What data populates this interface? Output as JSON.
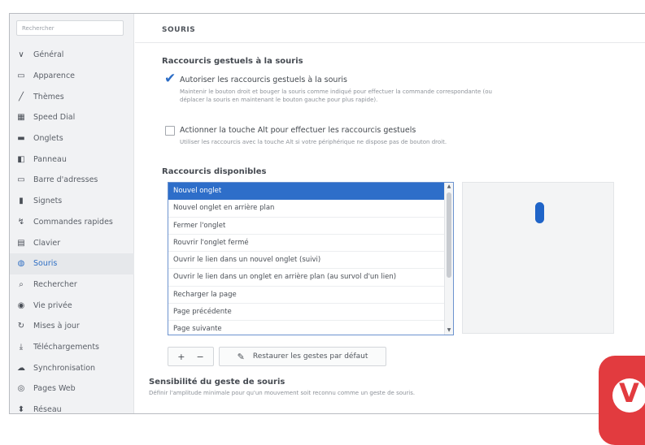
{
  "sidebar": {
    "search_placeholder": "Rechercher",
    "items": [
      {
        "label": "Général",
        "icon": "chevron-v-icon"
      },
      {
        "label": "Apparence",
        "icon": "folder-icon"
      },
      {
        "label": "Thèmes",
        "icon": "brush-icon"
      },
      {
        "label": "Speed Dial",
        "icon": "grid-icon"
      },
      {
        "label": "Onglets",
        "icon": "tabs-icon"
      },
      {
        "label": "Panneau",
        "icon": "panel-icon"
      },
      {
        "label": "Barre d'adresses",
        "icon": "address-bar-icon"
      },
      {
        "label": "Signets",
        "icon": "bookmark-icon"
      },
      {
        "label": "Commandes rapides",
        "icon": "quick-commands-icon"
      },
      {
        "label": "Clavier",
        "icon": "keyboard-icon"
      },
      {
        "label": "Souris",
        "icon": "mouse-icon"
      },
      {
        "label": "Rechercher",
        "icon": "search-icon"
      },
      {
        "label": "Vie privée",
        "icon": "privacy-icon"
      },
      {
        "label": "Mises à jour",
        "icon": "update-icon"
      },
      {
        "label": "Téléchargements",
        "icon": "download-icon"
      },
      {
        "label": "Synchronisation",
        "icon": "cloud-icon"
      },
      {
        "label": "Pages Web",
        "icon": "web-icon"
      },
      {
        "label": "Réseau",
        "icon": "network-icon"
      }
    ],
    "active_index": 10
  },
  "main": {
    "title": "SOURIS",
    "gestures_section": "Raccourcis gestuels à la souris",
    "option1": {
      "label": "Autoriser les raccourcis gestuels à la souris",
      "description": "Maintenir le bouton droit et bouger la souris comme indiqué pour effectuer la commande correspondante (ou déplacer la souris en maintenant le bouton gauche pour plus rapide).",
      "checked": true
    },
    "option2": {
      "label": "Actionner la touche Alt pour effectuer les raccourcis gestuels",
      "description": "Utiliser les raccourcis avec la touche Alt si votre périphérique ne dispose pas de bouton droit.",
      "checked": false
    },
    "available_section": "Raccourcis disponibles",
    "gesture_list": [
      "Nouvel onglet",
      "Nouvel onglet en arrière plan",
      "Fermer l'onglet",
      "Rouvrir l'onglet fermé",
      "Ouvrir le lien dans un nouvel onglet (suivi)",
      "Ouvrir le lien dans un onglet en arrière plan (au survol d'un lien)",
      "Recharger la page",
      "Page précédente",
      "Page suivante"
    ],
    "selected_index": 0,
    "toolbar": {
      "add": "+",
      "remove": "−",
      "edit_icon": "pencil-icon",
      "reset_label": "Restaurer les gestes par défaut"
    },
    "sensitivity_section": "Sensibilité du geste de souris",
    "sensitivity_desc": "Définir l'amplitude minimale pour qu'un mouvement soit reconnu comme un geste de souris."
  },
  "colors": {
    "accent": "#2e6ec9",
    "badge": "#e23b3f"
  }
}
